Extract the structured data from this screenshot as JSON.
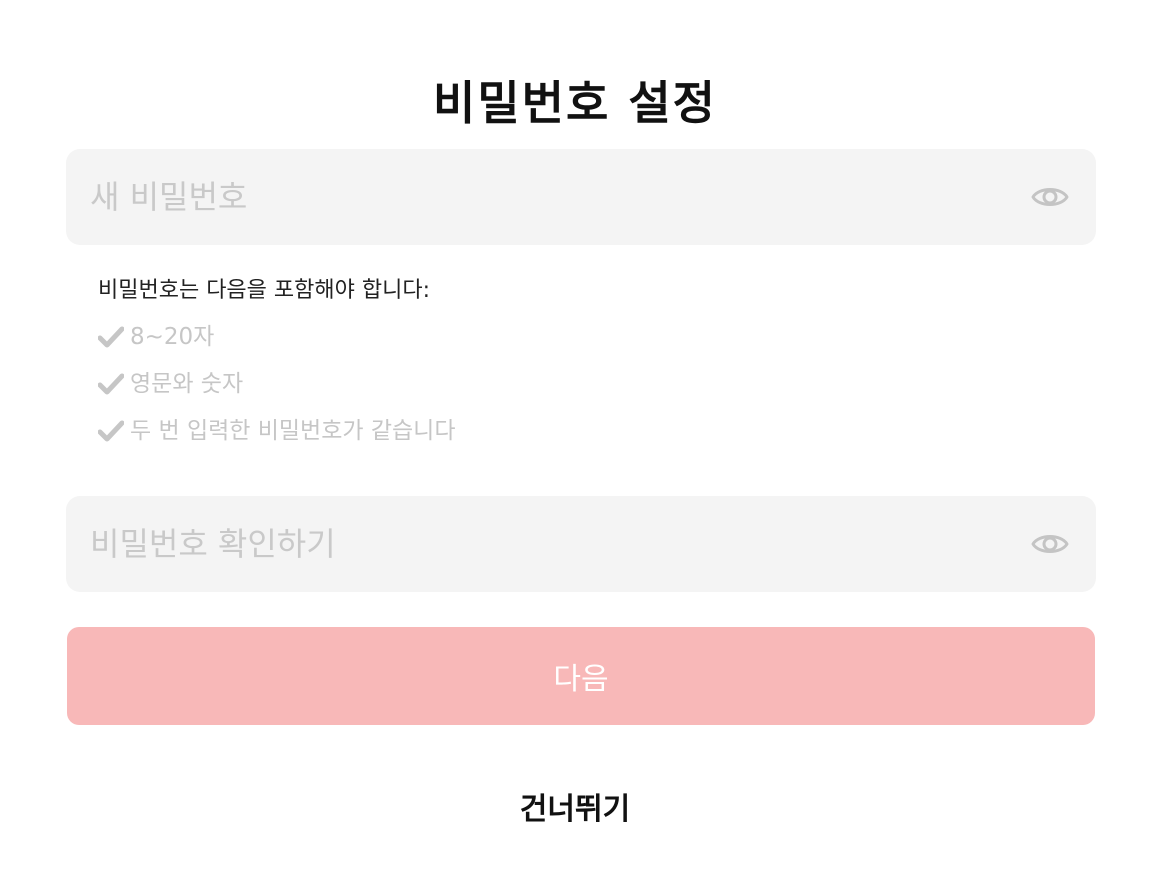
{
  "page": {
    "title": "비밀번호 설정"
  },
  "new_password": {
    "placeholder": "새 비밀번호",
    "value": "",
    "icon": "eye-icon"
  },
  "requirements": {
    "title": "비밀번호는 다음을 포함해야 합니다:",
    "check_icon": "check-icon",
    "check_color": "#c6c6c6",
    "items": [
      {
        "label": "8~20자"
      },
      {
        "label": "영문와 숫자"
      },
      {
        "label": "두 번 입력한 비밀번호가 같습니다"
      }
    ]
  },
  "confirm_password": {
    "placeholder": "비밀번호 확인하기",
    "value": "",
    "icon": "eye-icon"
  },
  "actions": {
    "next_label": "다음",
    "next_color": "#f8b8b8",
    "skip_label": "건너뛰기"
  }
}
